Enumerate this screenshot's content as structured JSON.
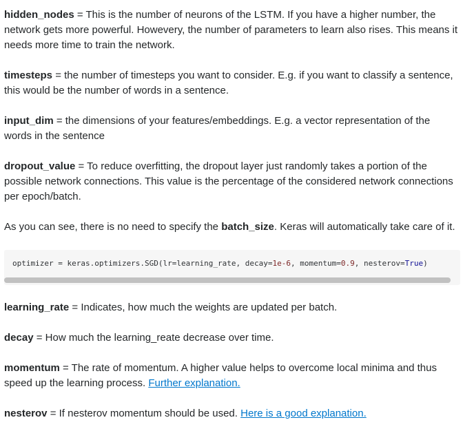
{
  "params": [
    {
      "term": "hidden_nodes",
      "text": " = This is the number of neurons of the LSTM. If you have a higher number, the network gets more powerful. Howevery, the number of parameters to learn also rises. This means it needs more time to train the network."
    },
    {
      "term": "timesteps",
      "text": " = the number of timesteps you want to consider. E.g. if you want to classify a sentence, this would be the number of words in a sentence."
    },
    {
      "term": "input_dim",
      "text": " = the dimensions of your features/embeddings. E.g. a vector representation of the words in the sentence"
    },
    {
      "term": "dropout_value",
      "text": " = To reduce overfitting, the dropout layer just randomly takes a portion of the possible network connections. This value is the percentage of the considered network connections per epoch/batch."
    }
  ],
  "batch_note": {
    "before": "As you can see, there is no need to specify the ",
    "term": "batch_size",
    "after": ". Keras will automatically take care of it."
  },
  "code": {
    "prefix": "optimizer = keras.optimizers.SGD(lr=learning_rate, decay=",
    "decay_value": "1e-6",
    "mid": ", momentum=",
    "momentum_value": "0.9",
    "mid2": ", nesterov=",
    "nesterov_value": "True",
    "suffix": ")"
  },
  "optimizer_params": [
    {
      "term": "learning_rate",
      "text": " = Indicates, how much the weights are updated per batch."
    },
    {
      "term": "decay",
      "text": " = How much the learning_reate decrease over time."
    }
  ],
  "momentum": {
    "term": "momentum",
    "text": " = The rate of momentum. A higher value helps to overcome local minima and thus speed up the learning process. ",
    "link": "Further explanation."
  },
  "nesterov": {
    "term": "nesterov",
    "text": " = If nesterov momentum should be used. ",
    "link": "Here is a good explanation."
  }
}
